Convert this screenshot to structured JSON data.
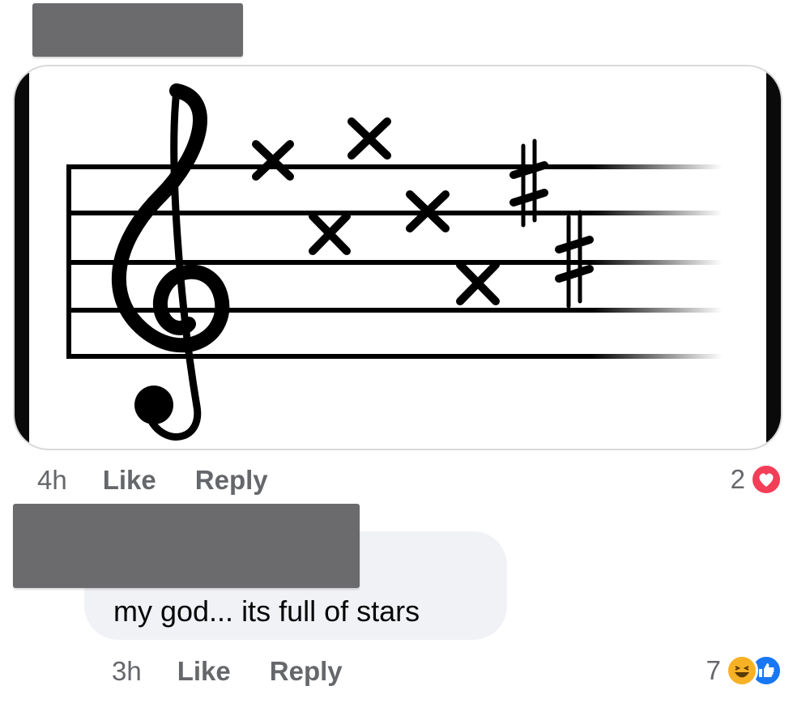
{
  "post": {
    "image_alt": "",
    "time": "4h",
    "like_label": "Like",
    "reply_label": "Reply",
    "reaction_count": "2",
    "reactions": [
      "heart-icon"
    ]
  },
  "comment": {
    "text": "my god... its full of stars",
    "time": "3h",
    "like_label": "Like",
    "reply_label": "Reply",
    "reaction_count": "7",
    "reactions": [
      "haha-icon",
      "like-icon"
    ]
  },
  "colors": {
    "meta_text": "#65676b",
    "bubble_bg": "#f0f2f5",
    "heart": "#f33e58",
    "like_blue": "#1877f2",
    "haha_yellow": "#f7b125",
    "redaction": "#6b6b6d"
  }
}
